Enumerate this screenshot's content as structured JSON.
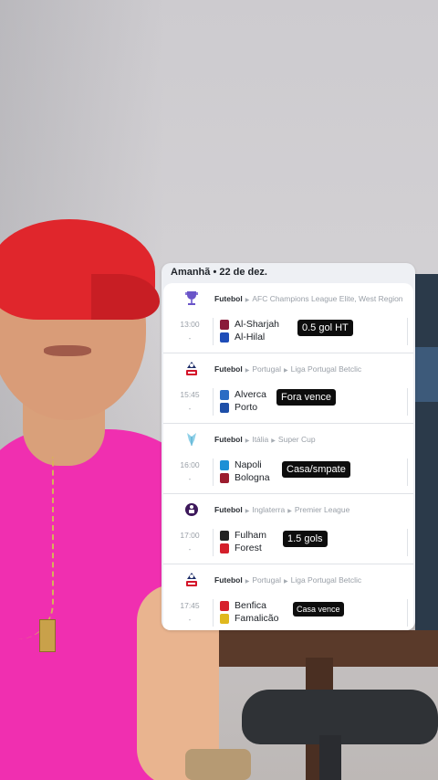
{
  "header": {
    "date_label": "Amanhã • 22 de dez."
  },
  "matches": [
    {
      "sport": "Futebol",
      "country": "",
      "competition": "AFC Champions League Elite, West Region",
      "competition_icon": "trophy-icon",
      "time": "13:00",
      "status": "-",
      "home": "Al-Sharjah",
      "away": "Al-Hilal",
      "tip": "0.5 gol HT",
      "home_color": "#8a1a3a",
      "away_color": "#1f4db8"
    },
    {
      "sport": "Futebol",
      "country": "Portugal",
      "competition": "Liga Portugal Betclic",
      "competition_icon": "liga-portugal-icon",
      "time": "15:45",
      "status": "-",
      "home": "Alverca",
      "away": "Porto",
      "tip": "Fora vence",
      "home_color": "#2b6cc4",
      "away_color": "#1e4fa8"
    },
    {
      "sport": "Futebol",
      "country": "Itália",
      "competition": "Super Cup",
      "competition_icon": "supercup-icon",
      "time": "16:00",
      "status": "-",
      "home": "Napoli",
      "away": "Bologna",
      "tip": "Casa/smpate",
      "home_color": "#1e90d6",
      "away_color": "#9b1c2e"
    },
    {
      "sport": "Futebol",
      "country": "Inglaterra",
      "competition": "Premier League",
      "competition_icon": "premier-league-icon",
      "time": "17:00",
      "status": "-",
      "home": "Fulham",
      "away": "Forest",
      "tip": "1.5 gols",
      "home_color": "#222222",
      "away_color": "#d41f2b"
    },
    {
      "sport": "Futebol",
      "country": "Portugal",
      "competition": "Liga Portugal Betclic",
      "competition_icon": "liga-portugal-icon",
      "time": "17:45",
      "status": "-",
      "home": "Benfica",
      "away": "Famalicão",
      "tip": "Casa vence",
      "home_color": "#d6202c",
      "away_color": "#e0b81e"
    }
  ]
}
